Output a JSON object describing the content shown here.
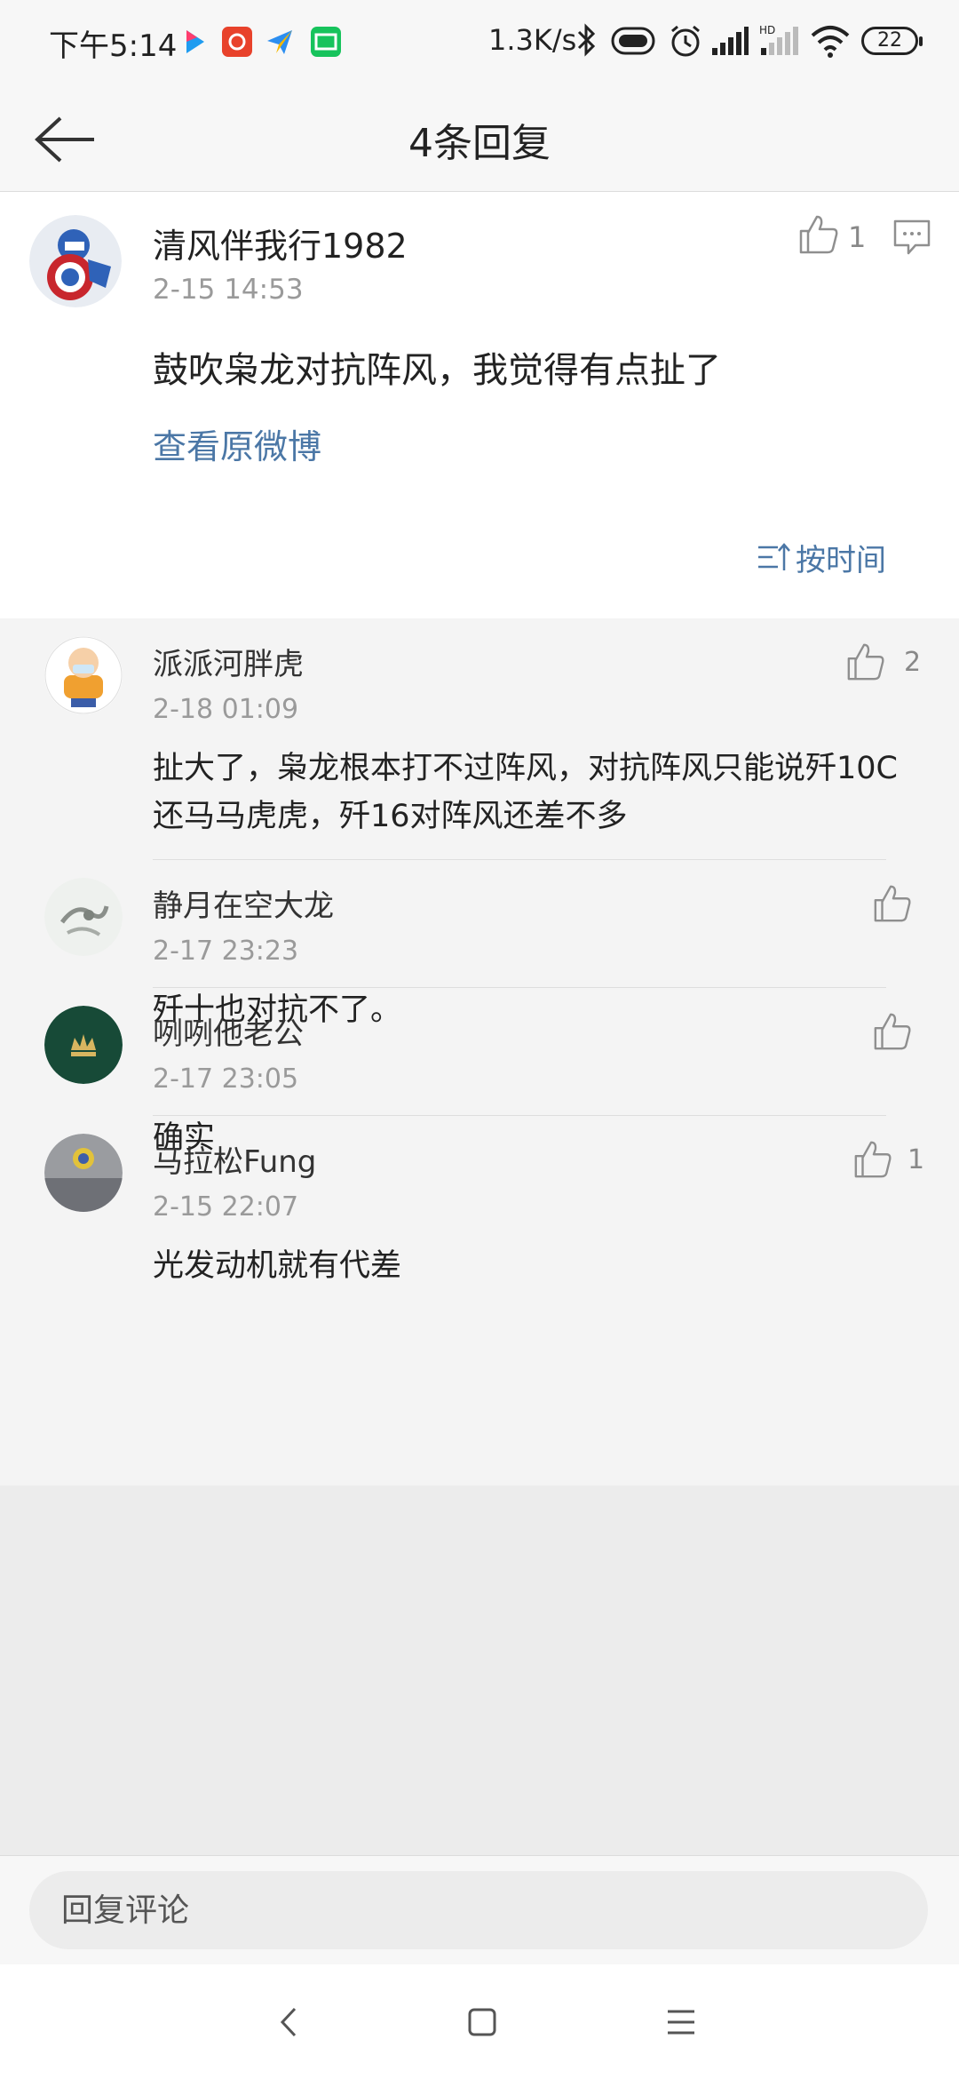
{
  "status_bar": {
    "time": "下午5:14",
    "network_speed": "1.3K/s",
    "battery": "22",
    "icons": [
      "youku-app-icon",
      "taobao-app-icon",
      "feiji-app-icon",
      "iqiyi-app-icon",
      "bluetooth-icon",
      "vibrate-icon",
      "alarm-icon",
      "signal-icon",
      "hd-signal-icon",
      "wifi-icon",
      "battery-icon"
    ]
  },
  "header": {
    "title": "4条回复"
  },
  "root_comment": {
    "user": "清风伴我行1982",
    "time": "2-15 14:53",
    "text": "鼓吹枭龙对抗阵风，我觉得有点扯了",
    "link": "查看原微博",
    "likes": "1",
    "sort_label": "按时间"
  },
  "replies": [
    {
      "user": "派派河胖虎",
      "time": "2-18 01:09",
      "text": "扯大了，枭龙根本打不过阵风，对抗阵风只能说歼10C还马马虎虎，歼16对阵风还差不多",
      "likes": "2"
    },
    {
      "user": "静月在空大龙",
      "time": "2-17 23:23",
      "text": "歼十也对抗不了。",
      "likes": ""
    },
    {
      "user": "咧咧他老公",
      "time": "2-17 23:05",
      "text": "确实",
      "likes": ""
    },
    {
      "user": "马拉松Fung",
      "time": "2-15 22:07",
      "text": "光发动机就有代差",
      "likes": "1"
    }
  ],
  "reply_input": {
    "placeholder": "回复评论"
  },
  "colors": {
    "link": "#4b77a6",
    "background": "#ececec",
    "reply_area": "#f4f4f4"
  }
}
